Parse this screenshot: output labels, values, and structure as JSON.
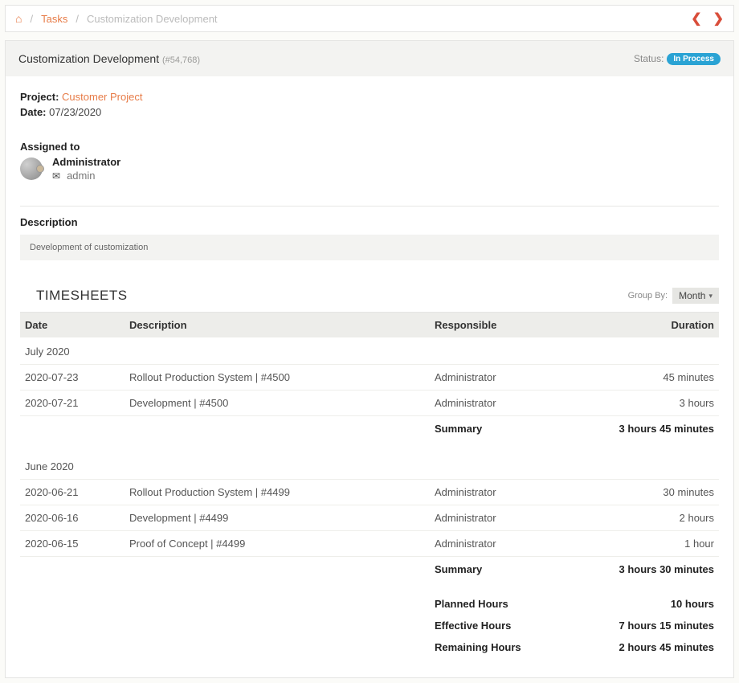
{
  "breadcrumb": {
    "tasks_label": "Tasks",
    "current": "Customization Development"
  },
  "header": {
    "title": "Customization Development",
    "task_id": "(#54,768)",
    "status_label": "Status:",
    "status_value": "In Process"
  },
  "meta": {
    "project_label": "Project:",
    "project_link": "Customer Project",
    "date_label": "Date:",
    "date_value": "07/23/2020"
  },
  "assigned": {
    "section_title": "Assigned to",
    "name": "Administrator",
    "username": "admin"
  },
  "description": {
    "title": "Description",
    "text": "Development of customization"
  },
  "timesheets": {
    "title": "TIMESHEETS",
    "groupby_label": "Group By:",
    "groupby_value": "Month",
    "columns": {
      "date": "Date",
      "description": "Description",
      "responsible": "Responsible",
      "duration": "Duration"
    },
    "groups": [
      {
        "label": "July 2020",
        "rows": [
          {
            "date": "2020-07-23",
            "desc": "Rollout Production System | #4500",
            "resp": "Administrator",
            "dur": "45 minutes"
          },
          {
            "date": "2020-07-21",
            "desc": "Development | #4500",
            "resp": "Administrator",
            "dur": "3 hours"
          }
        ],
        "summary_label": "Summary",
        "summary_value": "3 hours 45 minutes"
      },
      {
        "label": "June 2020",
        "rows": [
          {
            "date": "2020-06-21",
            "desc": "Rollout Production System | #4499",
            "resp": "Administrator",
            "dur": "30 minutes"
          },
          {
            "date": "2020-06-16",
            "desc": "Development | #4499",
            "resp": "Administrator",
            "dur": "2 hours"
          },
          {
            "date": "2020-06-15",
            "desc": "Proof of Concept | #4499",
            "resp": "Administrator",
            "dur": "1 hour"
          }
        ],
        "summary_label": "Summary",
        "summary_value": "3 hours 30 minutes"
      }
    ],
    "totals": [
      {
        "label": "Planned Hours",
        "value": "10 hours"
      },
      {
        "label": "Effective Hours",
        "value": "7 hours 15 minutes"
      },
      {
        "label": "Remaining Hours",
        "value": "2 hours 45 minutes"
      }
    ]
  }
}
